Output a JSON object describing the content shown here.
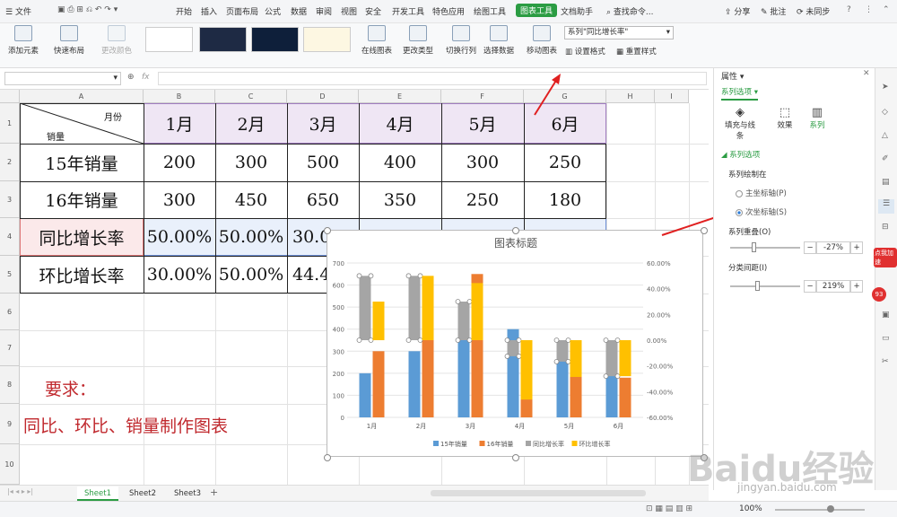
{
  "menubar": {
    "file": "文件",
    "tabs": [
      "开始",
      "插入",
      "页面布局",
      "公式",
      "数据",
      "审阅",
      "视图",
      "安全",
      "开发工具",
      "特色应用",
      "绘图工具",
      "图表工具",
      "文档助手"
    ],
    "search": "查找命令...",
    "share": "分享",
    "comment": "批注",
    "sync": "未同步"
  },
  "ribbon": {
    "add_element": "添加元素",
    "quick_layout": "快速布局",
    "change_color": "更改颜色",
    "online_chart": "在线图表",
    "change_type": "更改类型",
    "switch_rowcol": "切换行列",
    "select_data": "选择数据",
    "move_chart": "移动图表",
    "series_select": "系列\"同比增长率\"",
    "set_format": "设置格式",
    "reset_style": "重置样式"
  },
  "formula": {
    "fx": "fx"
  },
  "grid": {
    "columns": [
      "A",
      "B",
      "C",
      "D",
      "E",
      "F",
      "G",
      "H",
      "I"
    ],
    "rows": [
      "1",
      "2",
      "3",
      "4",
      "5",
      "6",
      "7",
      "8",
      "9",
      "10"
    ],
    "header_diag_top": "月份",
    "header_diag_bottom": "销量",
    "months": [
      "1月",
      "2月",
      "3月",
      "4月",
      "5月",
      "6月"
    ],
    "row_labels": [
      "15年销量",
      "16年销量",
      "同比增长率",
      "环比增长率"
    ],
    "sales15": [
      "200",
      "300",
      "500",
      "400",
      "300",
      "250"
    ],
    "sales16": [
      "300",
      "450",
      "650",
      "350",
      "250",
      "180"
    ],
    "yoy_visible": [
      "50.00%",
      "50.00%",
      "30.0"
    ],
    "mom_visible": [
      "30.00%",
      "50.00%",
      "44.4"
    ],
    "req_title": "要求：",
    "req_text": "同比、环比、销量制作图表"
  },
  "chart_data": {
    "type": "bar",
    "title": "图表标题",
    "categories": [
      "1月",
      "2月",
      "3月",
      "4月",
      "5月",
      "6月"
    ],
    "series": [
      {
        "name": "15年销量",
        "values": [
          200,
          300,
          500,
          400,
          300,
          250
        ],
        "axis": "primary",
        "color": "#5b9bd5"
      },
      {
        "name": "16年销量",
        "values": [
          300,
          450,
          650,
          350,
          250,
          180
        ],
        "axis": "primary",
        "color": "#ed7d31"
      },
      {
        "name": "同比增长率",
        "values": [
          50,
          50,
          30,
          -12.5,
          -16.67,
          -28
        ],
        "axis": "secondary",
        "color": "#a5a5a5"
      },
      {
        "name": "环比增长率",
        "values": [
          30,
          50,
          44.4,
          -46.15,
          -28.57,
          -28
        ],
        "axis": "secondary",
        "color": "#ffc000"
      }
    ],
    "y_ticks": [
      "0",
      "100",
      "200",
      "300",
      "400",
      "500",
      "600",
      "700"
    ],
    "ylim": [
      0,
      700
    ],
    "y2_ticks": [
      "60.00%",
      "40.00%",
      "20.00%",
      "0.00%",
      "-20.00%",
      "-40.00%",
      "-60.00%"
    ],
    "y2lim": [
      -60,
      60
    ],
    "legend": "bottom",
    "grid": true
  },
  "rpanel": {
    "title": "属性",
    "series_options": "系列选项",
    "tab_fill": "填充与线条",
    "tab_effect": "效果",
    "tab_series": "系列",
    "section": "系列选项",
    "plot_on": "系列绘制在",
    "primary_axis": "主坐标轴(P)",
    "secondary_axis": "次坐标轴(S)",
    "overlap_label": "系列重叠(O)",
    "overlap_value": "-27%",
    "gap_label": "分类间距(I)",
    "gap_value": "219%",
    "badge_speed": "点我加速",
    "badge_num": "93"
  },
  "sheets": [
    "Sheet1",
    "Sheet2",
    "Sheet3"
  ],
  "status": {
    "zoom": "100%"
  },
  "watermark": {
    "line1": "Baidu经验",
    "line2": "jingyan.baidu.com"
  }
}
